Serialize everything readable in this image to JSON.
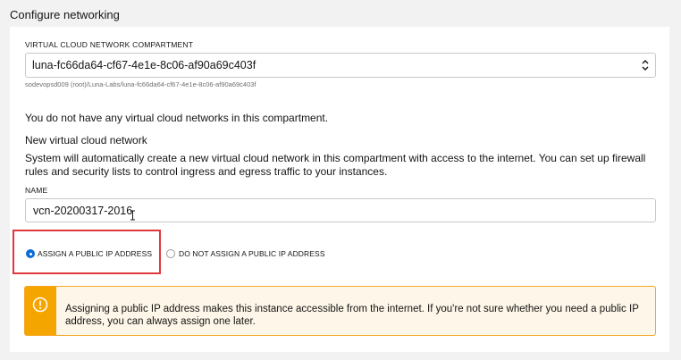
{
  "section": {
    "title": "Configure networking"
  },
  "compartment": {
    "label": "VIRTUAL CLOUD NETWORK COMPARTMENT",
    "selected_value": "luna-fc66da64-cf67-4e1e-8c06-af90a69c403f",
    "path_hint": "sodevopsd009 (root)/Luna-Labs/luna-fc66da64-cf67-4e1e-8c06-af90a69c403f"
  },
  "vcn": {
    "no_networks_message": "You do not have any virtual cloud networks in this compartment.",
    "new_heading": "New virtual cloud network",
    "description": "System will automatically create a new virtual cloud network in this compartment with access to the internet. You can set up firewall rules and security lists to control ingress and egress traffic to your instances.",
    "name_label": "NAME",
    "name_value": "vcn-20200317-2016"
  },
  "public_ip": {
    "options": [
      {
        "label": "ASSIGN A PUBLIC IP ADDRESS",
        "checked": true
      },
      {
        "label": "DO NOT ASSIGN A PUBLIC IP ADDRESS",
        "checked": false
      }
    ]
  },
  "alert": {
    "icon": "warning-circle-icon",
    "message": "Assigning a public IP address makes this instance accessible from the internet. If you're not sure whether you need a public IP address, you can always assign one later."
  },
  "colors": {
    "accent_blue": "#0b6cd6",
    "warning_orange": "#f5a500",
    "highlight_red": "#e0383e"
  }
}
